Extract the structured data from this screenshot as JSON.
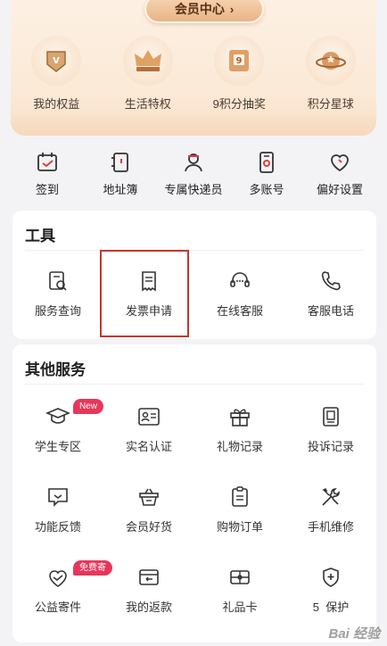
{
  "member": {
    "center_label": "会员中心",
    "perks": [
      {
        "label": "我的权益",
        "icon": "badge-v-icon"
      },
      {
        "label": "生活特权",
        "icon": "crown-icon"
      },
      {
        "label": "9积分抽奖",
        "icon": "lottery-machine-icon"
      },
      {
        "label": "积分星球",
        "icon": "planet-icon"
      }
    ]
  },
  "quick": [
    {
      "label": "签到",
      "icon": "calendar-check-icon"
    },
    {
      "label": "地址簿",
      "icon": "address-book-icon"
    },
    {
      "label": "专属快递员",
      "icon": "courier-icon"
    },
    {
      "label": "多账号",
      "icon": "multi-account-icon"
    },
    {
      "label": "偏好设置",
      "icon": "heart-icon"
    }
  ],
  "tools": {
    "title": "工具",
    "items": [
      {
        "label": "服务查询",
        "icon": "document-search-icon"
      },
      {
        "label": "发票申请",
        "icon": "receipt-icon"
      },
      {
        "label": "在线客服",
        "icon": "headset-icon"
      },
      {
        "label": "客服电话",
        "icon": "phone-icon"
      }
    ]
  },
  "services": {
    "title": "其他服务",
    "items": [
      {
        "label": "学生专区",
        "icon": "graduation-cap-icon",
        "badge": "New"
      },
      {
        "label": "实名认证",
        "icon": "id-card-icon"
      },
      {
        "label": "礼物记录",
        "icon": "gift-icon"
      },
      {
        "label": "投诉记录",
        "icon": "complaint-icon"
      },
      {
        "label": "功能反馈",
        "icon": "feedback-icon"
      },
      {
        "label": "会员好货",
        "icon": "shopping-basket-icon"
      },
      {
        "label": "购物订单",
        "icon": "order-list-icon"
      },
      {
        "label": "手机维修",
        "icon": "tools-icon"
      },
      {
        "label": "公益寄件",
        "icon": "charity-heart-icon",
        "badge": "免费寄"
      },
      {
        "label": "我的返款",
        "icon": "refund-icon"
      },
      {
        "label": "礼品卡",
        "icon": "gift-card-icon"
      },
      {
        "label": "5  保护",
        "icon": "shield-plus-icon"
      }
    ]
  },
  "watermark": "Bai 经验",
  "colors": {
    "accent_red": "#c8342f",
    "badge_pink": "#e8365b",
    "member_bg": "#fbe9d6"
  }
}
